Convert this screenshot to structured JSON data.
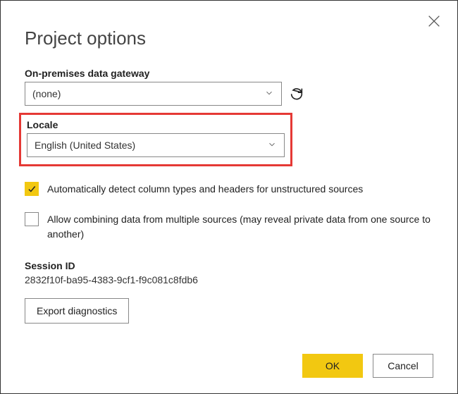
{
  "dialog": {
    "title": "Project options",
    "close_icon": "close"
  },
  "gateway": {
    "label": "On-premises data gateway",
    "value": "(none)",
    "refresh_icon": "refresh"
  },
  "locale": {
    "label": "Locale",
    "value": "English (United States)"
  },
  "options": {
    "auto_detect": {
      "checked": true,
      "label": "Automatically detect column types and headers for unstructured sources"
    },
    "allow_combine": {
      "checked": false,
      "label": "Allow combining data from multiple sources (may reveal private data from one source to another)"
    }
  },
  "session": {
    "label": "Session ID",
    "value": "2832f10f-ba95-4383-9cf1-f9c081c8fdb6"
  },
  "buttons": {
    "export": "Export diagnostics",
    "ok": "OK",
    "cancel": "Cancel"
  }
}
